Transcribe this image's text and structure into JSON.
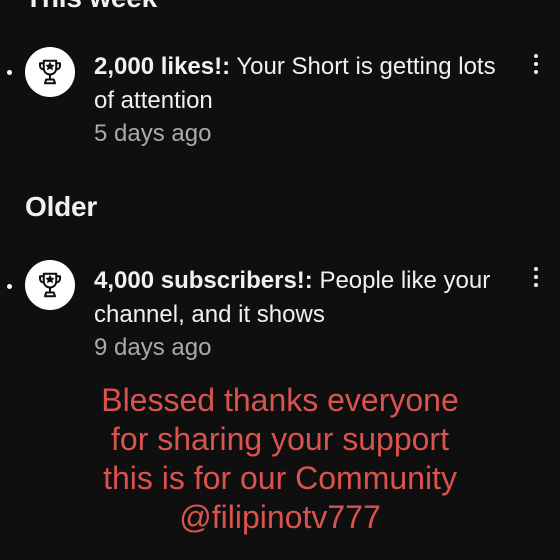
{
  "sections": {
    "top_title": "This week",
    "older_title": "Older"
  },
  "notifications": [
    {
      "bold": "2,000 likes!:",
      "message": " Your Short is getting lots of attention",
      "time": "5 days ago",
      "icon": "trophy-icon",
      "unread": true
    },
    {
      "bold": "4,000 subscribers!:",
      "message": " People like your channel, and it shows",
      "time": "9 days ago",
      "icon": "trophy-icon",
      "unread": true
    }
  ],
  "overlay": {
    "lines": [
      "Blessed thanks everyone",
      "for sharing your support",
      "this is for our Community",
      "@filipinotv777"
    ],
    "color": "#d9534f"
  },
  "colors": {
    "background": "#0f0f0f",
    "text_primary": "#f1f1f1",
    "text_secondary": "#aaaaaa"
  }
}
